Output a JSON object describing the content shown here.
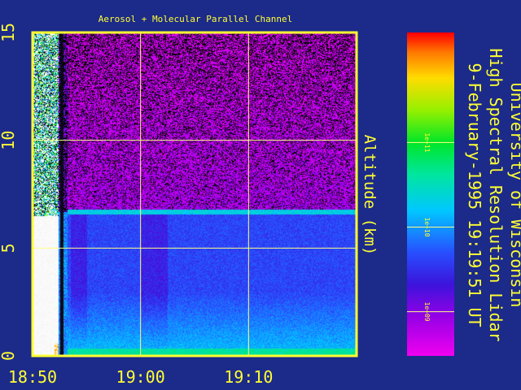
{
  "chart_data": {
    "type": "heatmap",
    "title": "Aerosol + Molecular Parallel Channel",
    "ylabel": "Altitude (km)",
    "xlabel": "",
    "xticks": [
      "18:50",
      "19:00",
      "19:10"
    ],
    "yticks": [
      "0",
      "5",
      "10",
      "15"
    ],
    "x_unit_minutes": true,
    "xlim_minutes": [
      0,
      30
    ],
    "ylim": [
      0,
      15
    ],
    "xtick_minutes": [
      0,
      10,
      20
    ],
    "ytick_values": [
      0,
      5,
      10,
      15
    ],
    "colorbar": {
      "ticks": [
        "1e+11",
        "1e+10",
        "1e+09"
      ],
      "tick_values": [
        100000000000.0,
        10000000000.0,
        1000000000.0
      ],
      "scale": "log",
      "range": [
        300000000.0,
        2000000000000.0
      ]
    },
    "features": {
      "cloud_layer_altitude_km": 6.7,
      "instrument_gap_end_minute": 3.2
    },
    "side_title": [
      "University of Wisconsin",
      "High Spectral Resolution Lidar",
      "9-February-1995 19:19:51 UT"
    ],
    "colors": {
      "background": "#1c2a8a",
      "frame": "#ffff33",
      "grid": "#ffff88"
    }
  }
}
